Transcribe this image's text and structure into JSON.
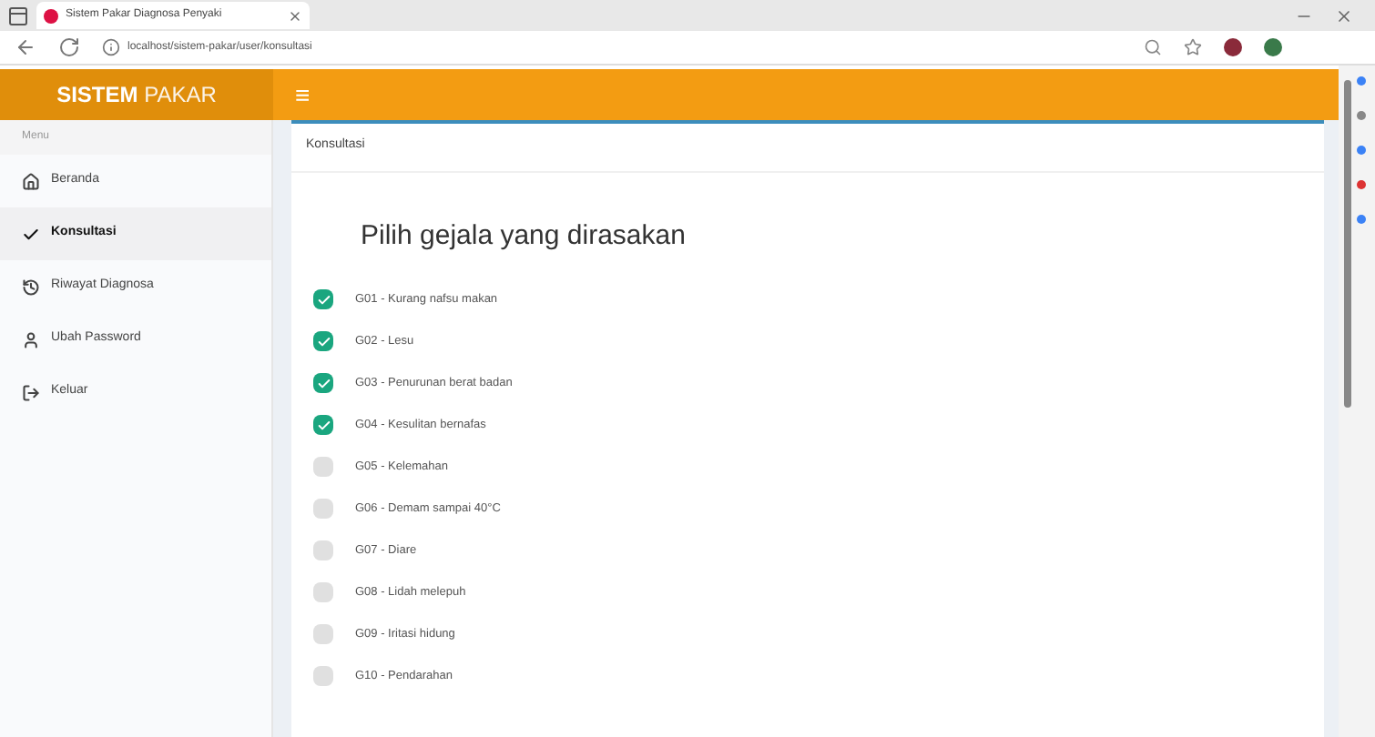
{
  "browser": {
    "tab_title": "Sistem Pakar Diagnosa Penyaki",
    "url": "localhost/sistem-pakar/user/konsultasi"
  },
  "header": {
    "brand_bold": "SISTEM",
    "brand_light": "PAKAR",
    "menu_icon": "≡"
  },
  "sidebar": {
    "heading": "Menu",
    "items": [
      {
        "label": "Beranda",
        "kind": "home",
        "selected": false
      },
      {
        "label": "Konsultasi",
        "kind": "consult",
        "selected": true
      },
      {
        "label": "Riwayat Diagnosa",
        "kind": "history",
        "selected": false
      },
      {
        "label": "Ubah Password",
        "kind": "account",
        "selected": false
      },
      {
        "label": "Keluar",
        "kind": "logout",
        "selected": false
      }
    ]
  },
  "page_title": "Konsultasi",
  "form": {
    "heading": "Pilih gejala yang dirasakan",
    "symptoms": [
      {
        "label": "G01 - Kurang nafsu makan",
        "checked": true
      },
      {
        "label": "G02 - Lesu",
        "checked": true
      },
      {
        "label": "G03 - Penurunan berat badan",
        "checked": true
      },
      {
        "label": "G04 - Kesulitan bernafas",
        "checked": true
      },
      {
        "label": "G05 - Kelemahan",
        "checked": false
      },
      {
        "label": "G06 - Demam sampai 40°C",
        "checked": false
      },
      {
        "label": "G07 - Diare",
        "checked": false
      },
      {
        "label": "G08 - Lidah melepuh",
        "checked": false
      },
      {
        "label": "G09 - Iritasi hidung",
        "checked": false
      },
      {
        "label": "G10 - Pendarahan",
        "checked": false
      }
    ]
  }
}
